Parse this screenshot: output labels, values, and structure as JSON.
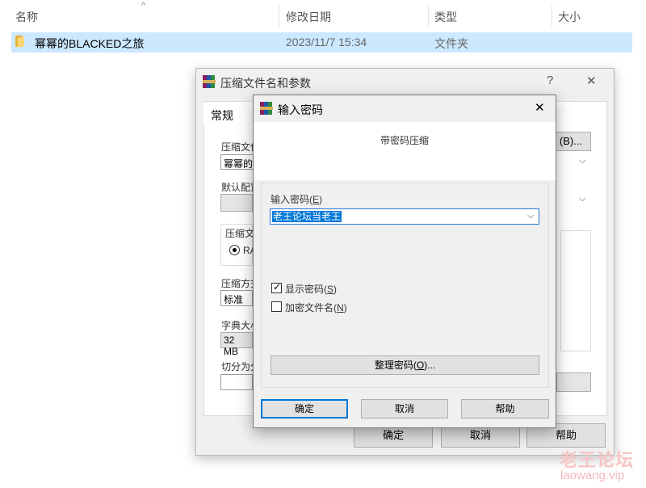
{
  "explorer": {
    "columns": {
      "name": "名称",
      "modified": "修改日期",
      "type": "类型",
      "size": "大小"
    },
    "sort_arrow": "^",
    "rows": [
      {
        "name": "幂幂的BLACKED之旅",
        "modified": "2023/11/7 15:34",
        "type": "文件夹"
      }
    ]
  },
  "main_dialog": {
    "title": "压缩文件名和参数",
    "help_glyph": "?",
    "close_glyph": "✕",
    "tab": "常规",
    "archive_label": "压缩文件",
    "archive_value": "幂幂的",
    "browse_button": "(B)...",
    "profile_label": "默认配置",
    "format_label": "压缩文",
    "format_value": "RA",
    "method_label": "压缩方式",
    "method_value": "标准",
    "dict_label": "字典大小",
    "dict_value": "32 MB",
    "split_label": "切分为分",
    "ok": "确定",
    "cancel": "取消",
    "help": "帮助"
  },
  "password_dialog": {
    "title": "输入密码",
    "close_glyph": "✕",
    "subtitle": "带密码压缩",
    "password_label": "输入密码(",
    "password_key": "E",
    "password_value": "老王论坛当老王",
    "show_password_label": "显示密码(",
    "show_password_key": "S",
    "show_password_checked": true,
    "encrypt_names_label": "加密文件名(",
    "encrypt_names_key": "N",
    "encrypt_names_checked": false,
    "organize_label": "整理密码(",
    "organize_key": "O",
    "organize_suffix": ")...",
    "ok": "确定",
    "cancel": "取消",
    "help": "帮助"
  },
  "watermark": {
    "line1": "老王论坛",
    "line2": "laowang.vip"
  },
  "colors": {
    "selection": "#0078d7",
    "row_highlight": "#cce8ff",
    "dialog_bg": "#f0f0f0"
  }
}
